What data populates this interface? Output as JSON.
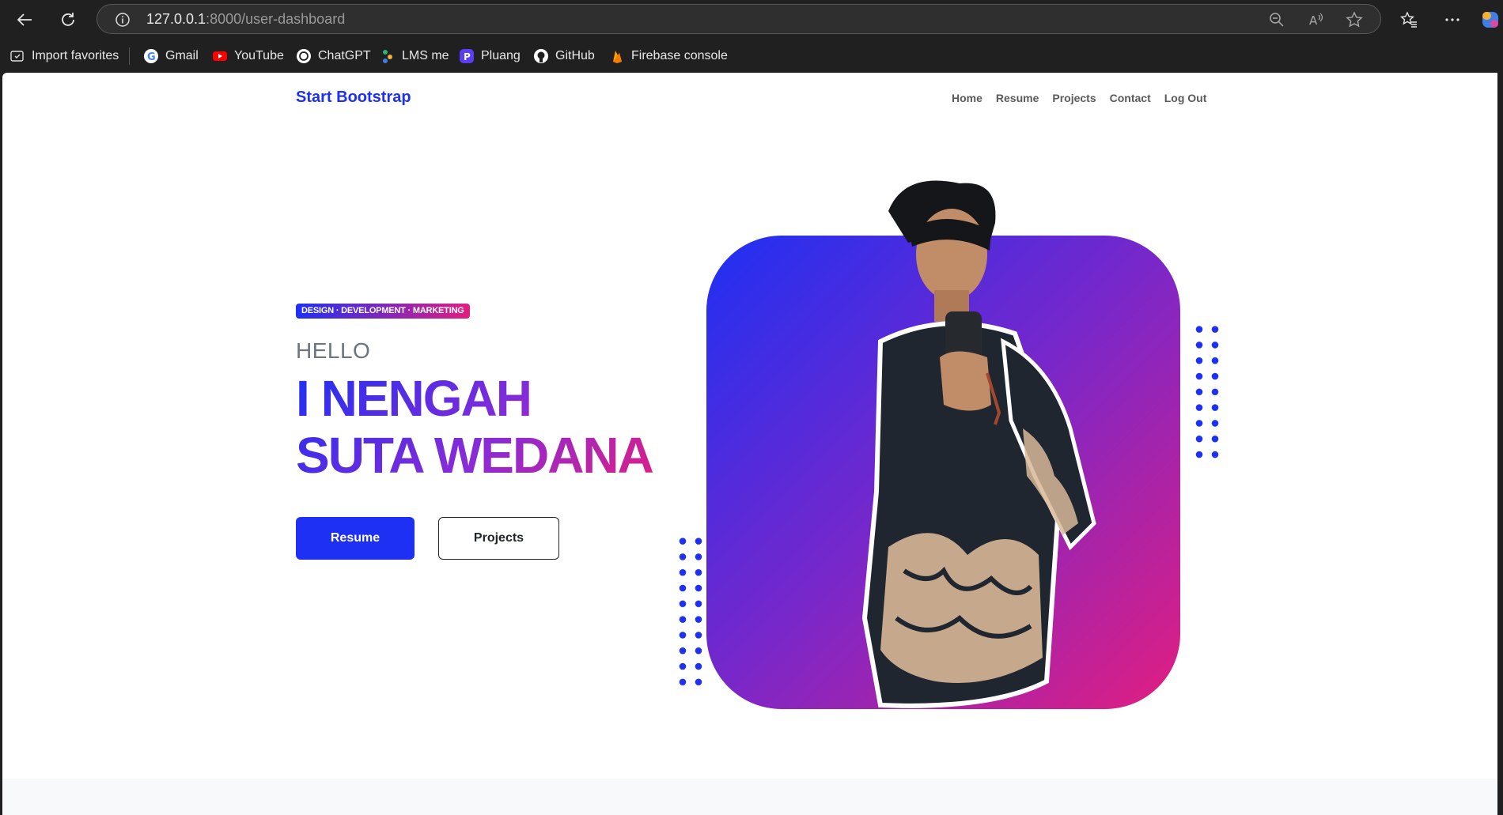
{
  "browser": {
    "url_host": "127.0.0.1",
    "url_path": ":8000/user-dashboard",
    "bookmarks": [
      {
        "label": "Import favorites",
        "icon": "import-favorites-icon"
      },
      {
        "label": "Gmail",
        "icon": "google-icon"
      },
      {
        "label": "YouTube",
        "icon": "youtube-icon"
      },
      {
        "label": "ChatGPT",
        "icon": "chatgpt-icon"
      },
      {
        "label": "LMS me",
        "icon": "lms-icon"
      },
      {
        "label": "Pluang",
        "icon": "pluang-icon"
      },
      {
        "label": "GitHub",
        "icon": "github-icon"
      },
      {
        "label": "Firebase console",
        "icon": "firebase-icon"
      }
    ]
  },
  "navbar": {
    "brand": "Start Bootstrap",
    "links": [
      "Home",
      "Resume",
      "Projects",
      "Contact",
      "Log Out"
    ]
  },
  "hero": {
    "tagline": "DESIGN · DEVELOPMENT · MARKETING",
    "greeting": "HELLO",
    "name": "I NENGAH SUTA WEDANA",
    "primary_button": "Resume",
    "secondary_button": "Projects"
  },
  "colors": {
    "brand_blue": "#1e30f3",
    "brand_pink": "#e21e80",
    "chrome_bg": "#202020"
  }
}
